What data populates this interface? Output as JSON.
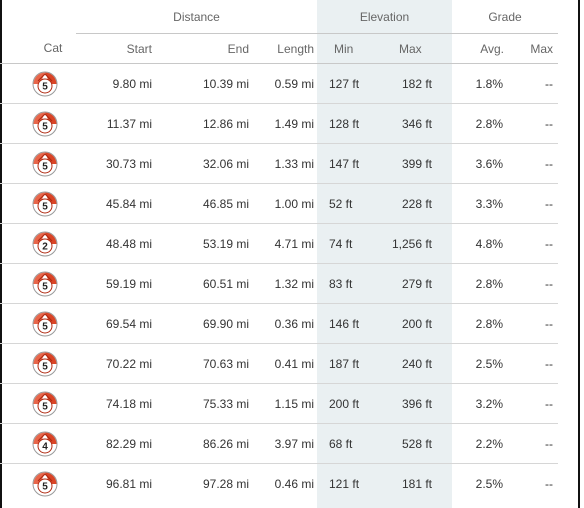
{
  "headers": {
    "distance": "Distance",
    "elevation": "Elevation",
    "grade": "Grade",
    "cat": "Cat",
    "start": "Start",
    "end": "End",
    "length": "Length",
    "min": "Min",
    "max": "Max",
    "avg": "Avg.",
    "grade_max": "Max"
  },
  "climb_icon": "climb-category-icon",
  "colors": {
    "badge_accent": "#d94426",
    "elevation_band": "#eaf0f2"
  },
  "rows": [
    {
      "cat": "5",
      "start": "9.80 mi",
      "end": "10.39 mi",
      "length": "0.59 mi",
      "min": "127 ft",
      "max": "182 ft",
      "avg": "1.8%",
      "grade_max": "--"
    },
    {
      "cat": "5",
      "start": "11.37 mi",
      "end": "12.86 mi",
      "length": "1.49 mi",
      "min": "128 ft",
      "max": "346 ft",
      "avg": "2.8%",
      "grade_max": "--"
    },
    {
      "cat": "5",
      "start": "30.73 mi",
      "end": "32.06 mi",
      "length": "1.33 mi",
      "min": "147 ft",
      "max": "399 ft",
      "avg": "3.6%",
      "grade_max": "--"
    },
    {
      "cat": "5",
      "start": "45.84 mi",
      "end": "46.85 mi",
      "length": "1.00 mi",
      "min": "52 ft",
      "max": "228 ft",
      "avg": "3.3%",
      "grade_max": "--"
    },
    {
      "cat": "2",
      "start": "48.48 mi",
      "end": "53.19 mi",
      "length": "4.71 mi",
      "min": "74 ft",
      "max": "1,256 ft",
      "avg": "4.8%",
      "grade_max": "--"
    },
    {
      "cat": "5",
      "start": "59.19 mi",
      "end": "60.51 mi",
      "length": "1.32 mi",
      "min": "83 ft",
      "max": "279 ft",
      "avg": "2.8%",
      "grade_max": "--"
    },
    {
      "cat": "5",
      "start": "69.54 mi",
      "end": "69.90 mi",
      "length": "0.36 mi",
      "min": "146 ft",
      "max": "200 ft",
      "avg": "2.8%",
      "grade_max": "--"
    },
    {
      "cat": "5",
      "start": "70.22 mi",
      "end": "70.63 mi",
      "length": "0.41 mi",
      "min": "187 ft",
      "max": "240 ft",
      "avg": "2.5%",
      "grade_max": "--"
    },
    {
      "cat": "5",
      "start": "74.18 mi",
      "end": "75.33 mi",
      "length": "1.15 mi",
      "min": "200 ft",
      "max": "396 ft",
      "avg": "3.2%",
      "grade_max": "--"
    },
    {
      "cat": "4",
      "start": "82.29 mi",
      "end": "86.26 mi",
      "length": "3.97 mi",
      "min": "68 ft",
      "max": "528 ft",
      "avg": "2.2%",
      "grade_max": "--"
    },
    {
      "cat": "5",
      "start": "96.81 mi",
      "end": "97.28 mi",
      "length": "0.46 mi",
      "min": "121 ft",
      "max": "181 ft",
      "avg": "2.5%",
      "grade_max": "--"
    }
  ]
}
